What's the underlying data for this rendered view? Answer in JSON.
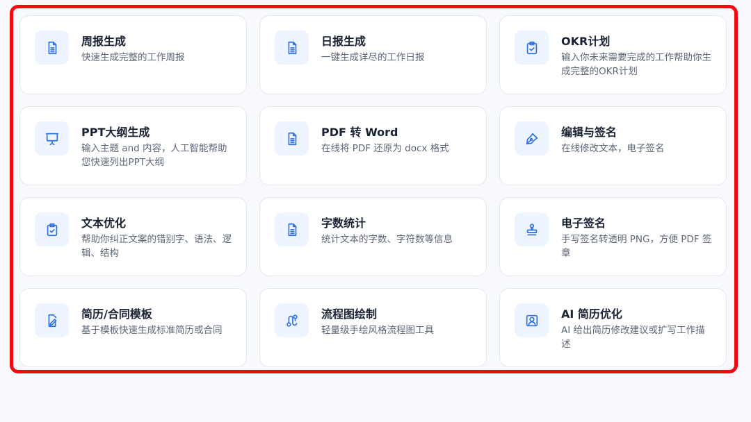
{
  "tools": [
    {
      "title": "周报生成",
      "desc": "快速生成完整的工作周报",
      "icon": "document-icon"
    },
    {
      "title": "日报生成",
      "desc": "一键生成详尽的工作日报",
      "icon": "document-icon"
    },
    {
      "title": "OKR计划",
      "desc": "输入你未来需要完成的工作帮助你生成完整的OKR计划",
      "icon": "clipboard-check-icon"
    },
    {
      "title": "PPT大纲生成",
      "desc": "输入主题 and 内容，人工智能帮助您快速列出PPT大纲",
      "icon": "presentation-icon"
    },
    {
      "title": "PDF 转 Word",
      "desc": "在线将 PDF 还原为 docx 格式",
      "icon": "document-icon"
    },
    {
      "title": "编辑与签名",
      "desc": "在线修改文本，电子签名",
      "icon": "pen-nib-icon"
    },
    {
      "title": "文本优化",
      "desc": "帮助你纠正文案的错别字、语法、逻辑、结构",
      "icon": "clipboard-check-icon"
    },
    {
      "title": "字数统计",
      "desc": "统计文本的字数、字符数等信息",
      "icon": "document-icon"
    },
    {
      "title": "电子签名",
      "desc": "手写签名转透明 PNG，方便 PDF 签章",
      "icon": "stamp-icon"
    },
    {
      "title": "简历/合同模板",
      "desc": "基于模板快速生成标准简历或合同",
      "icon": "file-signature-icon"
    },
    {
      "title": "流程图绘制",
      "desc": "轻量级手绘风格流程图工具",
      "icon": "flow-path-icon"
    },
    {
      "title": "AI 简历优化",
      "desc": "AI 给出简历修改建议或扩写工作描述",
      "icon": "user-portrait-icon"
    }
  ],
  "colors": {
    "accent": "#2f6fe4",
    "icon_bg": "#eef4ff",
    "highlight_border": "#ef0b10",
    "page_bg": "#f7f9fc"
  }
}
